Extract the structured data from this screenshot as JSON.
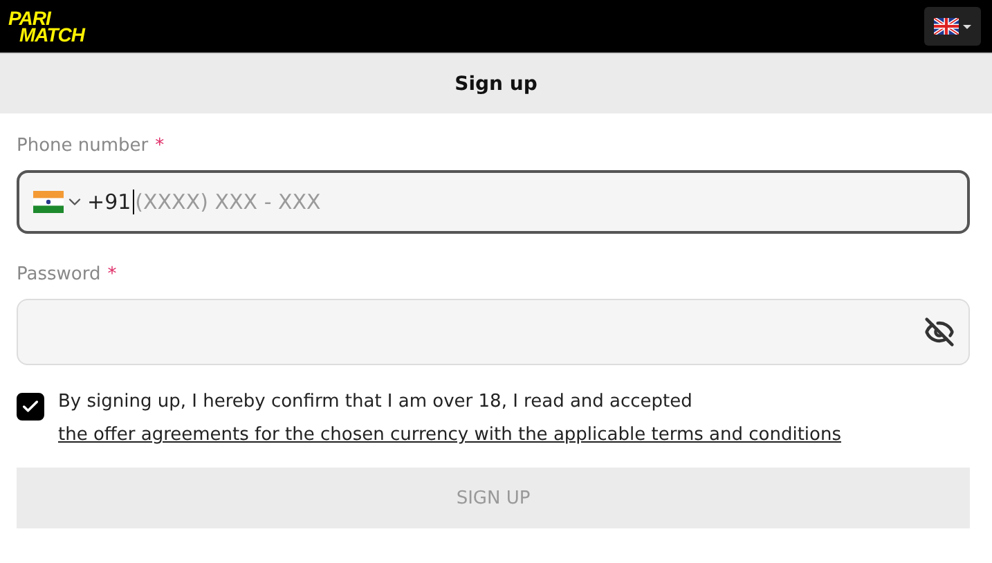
{
  "header": {
    "logo": [
      "PARI",
      "MATCH"
    ]
  },
  "page": {
    "title": "Sign up"
  },
  "phone": {
    "label": "Phone number",
    "required_mark": "*",
    "value": "+91",
    "mask": "(XXXX) XXX - XXX",
    "focused": true
  },
  "password": {
    "label": "Password",
    "required_mark": "*",
    "focused": false
  },
  "agreement": {
    "checked": true,
    "text": "By signing up, I hereby confirm that I am over 18, I read and accepted",
    "link": "the offer agreements for the chosen currency with the applicable terms and conditions"
  },
  "submit": {
    "label": "SIGN UP",
    "disabled": true
  }
}
